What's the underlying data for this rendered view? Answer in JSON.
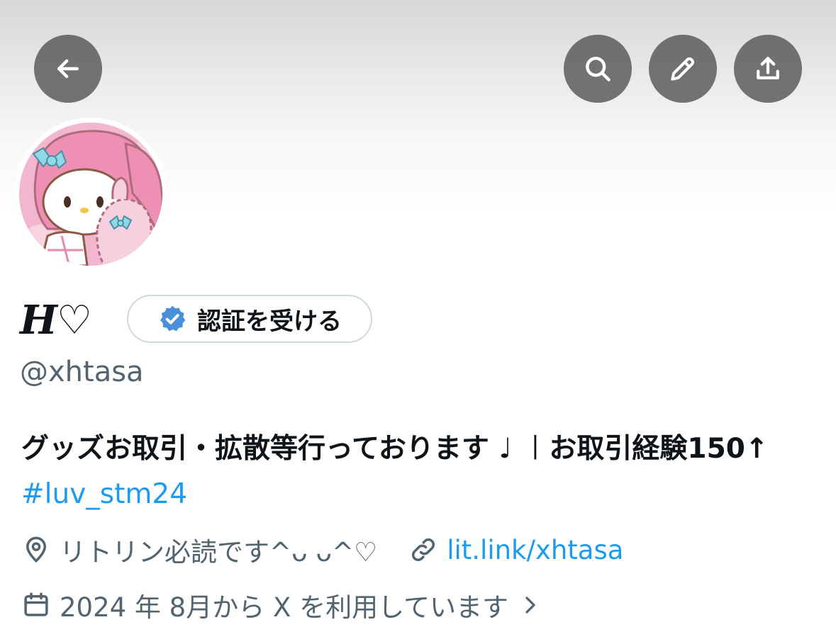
{
  "header": {
    "back_icon": "arrow-left-icon",
    "search_icon": "search-icon",
    "edit_icon": "pencil-icon",
    "share_icon": "share-upload-icon",
    "button_bg": "#555555"
  },
  "profile": {
    "display_name": "H♡",
    "verify_button_label": "認証を受ける",
    "handle": "@xhtasa",
    "bio_text": "グッズお取引・拡散等行っております ♩ ︱お取引経験150↑ ",
    "bio_hashtag": "#luv_stm24",
    "location": "リトリン必読です^ᴗ ᴗ^♡",
    "link": "lit.link/xhtasa",
    "joined": "2024 年 8月から X を利用しています"
  },
  "colors": {
    "accent": "#1d9bf0",
    "secondary_text": "#536471",
    "primary_text": "#0f1419",
    "verify_badge": "#4a90d9"
  }
}
